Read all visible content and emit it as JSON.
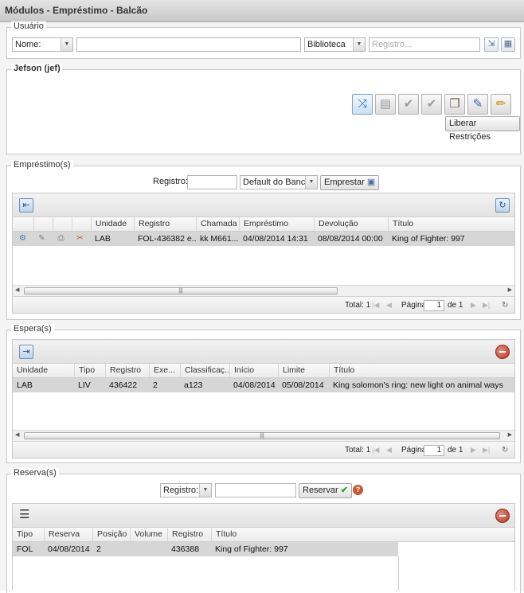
{
  "window": {
    "title": "Módulos - Empréstimo - Balcão"
  },
  "usuario": {
    "legend": "Usuário",
    "field_select": "Nome:",
    "biblioteca_select": "Biblioteca",
    "registro_placeholder": "Registro...",
    "user_name": "Jefson (jef)",
    "liberar_label": "Liberar Restrições",
    "actions": [
      "shuffle-icon",
      "document-icon",
      "check-icon",
      "check-icon",
      "copy-icon",
      "edit-icon",
      "pencil-icon"
    ]
  },
  "emprestimo": {
    "legend": "Empréstimo(s)",
    "registro_label": "Registro:",
    "banco_select": "Default do Banco",
    "emprestar_label": "Emprestar",
    "columns": [
      "Unidade",
      "Registro",
      "Chamada",
      "Empréstimo",
      "Devolução",
      "Título"
    ],
    "rows": [
      {
        "unidade": "LAB",
        "registro": "FOL-436382 e...",
        "chamada": "kk M661...",
        "emprestimo": "04/08/2014 14:31",
        "devolucao": "08/08/2014 00:00",
        "titulo": "King of Fighter: 997"
      }
    ],
    "pager": {
      "total": "Total: 1",
      "pagina": "Página",
      "page": "1",
      "of": "de 1"
    }
  },
  "espera": {
    "legend": "Espera(s)",
    "columns": [
      "Unidade",
      "Tipo",
      "Registro",
      "Exe...",
      "Classificaç...",
      "Início",
      "Limite",
      "Título"
    ],
    "rows": [
      {
        "unidade": "LAB",
        "tipo": "LIV",
        "registro": "436422",
        "exe": "2",
        "classificacao": "a123",
        "inicio": "04/08/2014",
        "limite": "05/08/2014",
        "titulo": "King solomon's ring: new light on animal ways"
      }
    ],
    "pager": {
      "total": "Total: 1",
      "pagina": "Página",
      "page": "1",
      "of": "de 1"
    }
  },
  "reserva": {
    "legend": "Reserva(s)",
    "registro_select": "Registro:",
    "reservar_label": "Reservar",
    "columns": [
      "Tipo",
      "Reserva",
      "Posição",
      "Volume",
      "Registro",
      "Título"
    ],
    "rows": [
      {
        "tipo": "FOL",
        "reserva": "04/08/2014",
        "posicao": "2",
        "volume": "",
        "registro": "436388",
        "titulo": "King of Fighter: 997"
      }
    ]
  },
  "colors": {
    "accent": "#4a6d9a",
    "row_selected": "#d6d6d6",
    "remove": "#b53b26",
    "check": "#2e9b2e"
  }
}
